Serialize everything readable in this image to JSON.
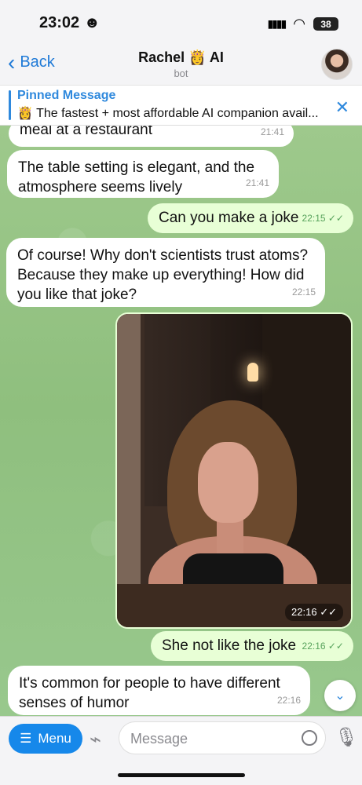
{
  "status": {
    "time": "23:02",
    "time_emoji": "☻",
    "battery": "38"
  },
  "header": {
    "back": "Back",
    "title": "Rachel 👸 AI",
    "subtitle": "bot"
  },
  "pinned": {
    "title": "Pinned Message",
    "text": "👸 The fastest + most affordable AI companion avail..."
  },
  "messages": [
    {
      "type": "in",
      "text": "meal at a restaurant",
      "time": "21:41"
    },
    {
      "type": "in",
      "text": "The table setting is elegant, and the atmosphere seems lively",
      "time": "21:41"
    },
    {
      "type": "out",
      "text": "Can you make a joke",
      "time": "22:15"
    },
    {
      "type": "in",
      "text": "Of course! Why don't scientists trust atoms? Because they make up everything! How did you like that joke?",
      "time": "22:15"
    },
    {
      "type": "photo",
      "time": "22:16"
    },
    {
      "type": "out",
      "text": "She not like the joke",
      "time": "22:16"
    },
    {
      "type": "in",
      "text": "It's common for people to have different senses of humor",
      "time": "22:16"
    }
  ],
  "composer": {
    "menu": "Menu",
    "placeholder": "Message"
  }
}
